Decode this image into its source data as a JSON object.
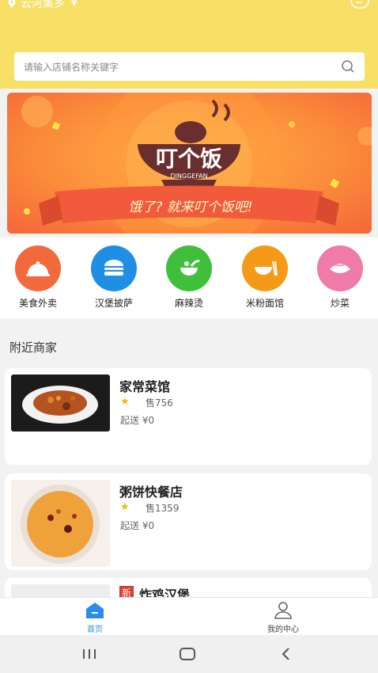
{
  "header": {
    "location": "云河集乡"
  },
  "search": {
    "placeholder": "请输入店铺名称关键字"
  },
  "banner": {
    "logo_text": "叮个饭",
    "logo_sub": "DINGGEFAN",
    "slogan": "饿了? 就来叮个饭吧!"
  },
  "categories": [
    {
      "label": "美食外卖",
      "color": "#f26a3b"
    },
    {
      "label": "汉堡披萨",
      "color": "#1f8fe6"
    },
    {
      "label": "麻辣烫",
      "color": "#3fbf3a"
    },
    {
      "label": "米粉面馆",
      "color": "#f59a16"
    },
    {
      "label": "炒菜",
      "color": "#f07aa8"
    }
  ],
  "nearby": {
    "title": "附近商家",
    "shops": [
      {
        "name": "家常菜馆",
        "sold": "售756",
        "delivery": "起送 ¥0"
      },
      {
        "name": "粥饼快餐店",
        "sold": "售1359",
        "delivery": "起送 ¥0"
      },
      {
        "badge": "新",
        "name": "炸鸡汉堡"
      }
    ]
  },
  "tabbar": {
    "home": "首页",
    "profile": "我的中心"
  },
  "colors": {
    "header": "#f8df66",
    "active_tab": "#2a8cf0"
  }
}
